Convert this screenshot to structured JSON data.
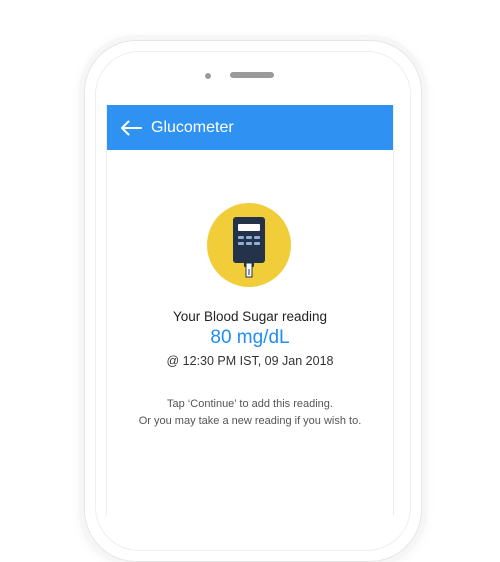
{
  "app_bar": {
    "title": "Glucometer",
    "background": "#2f92f2",
    "back_icon": "arrow-left-icon"
  },
  "illustration": {
    "icon": "glucometer-icon",
    "circle_color": "#f2cd3a"
  },
  "reading": {
    "label": "Your Blood Sugar reading",
    "value": "80 mg/dL",
    "value_color": "#1e8ef0",
    "timestamp": "@ 12:30 PM IST, 09 Jan 2018"
  },
  "hint": {
    "line1": "Tap ‘Continue’ to add this reading.",
    "line2": "Or you may take a new reading if you wish to."
  }
}
